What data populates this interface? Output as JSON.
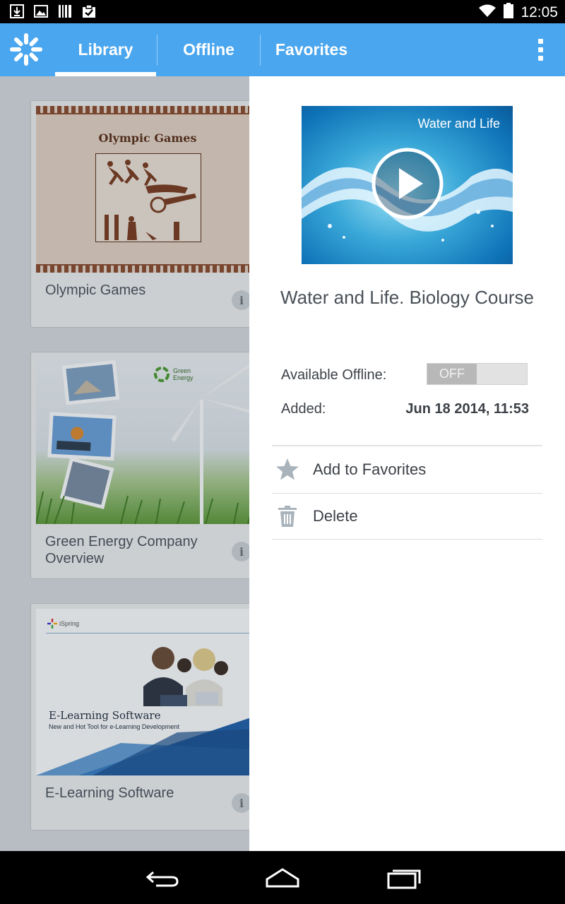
{
  "status_bar": {
    "time": "12:05",
    "icons": [
      "download-icon",
      "image-icon",
      "barcode-icon",
      "clipboard-check-icon",
      "wifi-icon",
      "battery-icon"
    ]
  },
  "app_bar": {
    "logo": "app-logo-icon",
    "tabs": [
      {
        "label": "Library",
        "active": true
      },
      {
        "label": "Offline",
        "active": false
      },
      {
        "label": "Favorites",
        "active": false
      }
    ],
    "menu_icon": "overflow-menu-icon"
  },
  "library": {
    "items": [
      {
        "title": "Olympic Games",
        "thumb_heading": "Olympic Games"
      },
      {
        "title": "Green Energy Company Overview",
        "thumb_brand": "Green Energy"
      },
      {
        "title": "E-Learning Software",
        "thumb_brand": "iSpring",
        "thumb_heading": "E-Learning Software",
        "thumb_subheading": "New and Hot Tool for e-Learning Development"
      }
    ],
    "info_glyph": "i"
  },
  "details": {
    "video_label": "Water and Life",
    "title": "Water and Life. Biology Course",
    "available_offline_label": "Available Offline:",
    "toggle_state": "OFF",
    "added_label": "Added:",
    "added_value": "Jun 18 2014, 11:53",
    "actions": [
      {
        "label": "Add to Favorites",
        "icon": "star-icon"
      },
      {
        "label": "Delete",
        "icon": "trash-icon"
      }
    ]
  },
  "colors": {
    "accent": "#4aa6ee",
    "panel_bg": "#ffffff",
    "text": "#4a5058"
  }
}
